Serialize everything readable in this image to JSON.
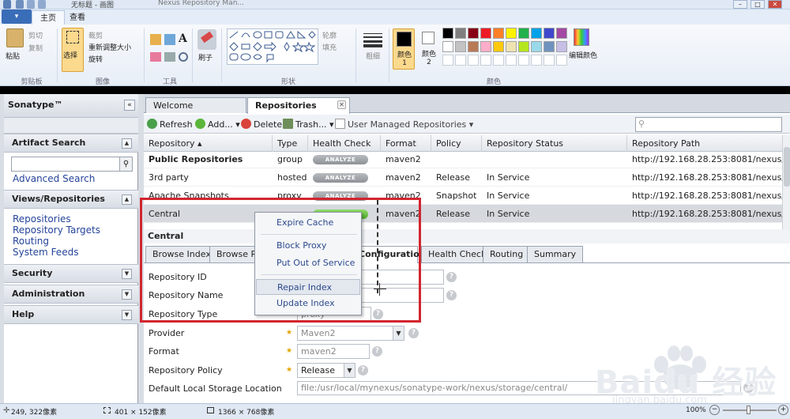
{
  "paint": {
    "title": "无标题 - 画图",
    "bg_tab": "Nexus Repository Man...",
    "file_menu": "▾",
    "tabs": [
      "主页",
      "查看"
    ],
    "clipboard": {
      "paste": "粘贴",
      "cut": "剪切",
      "copy": "复制",
      "label": "剪贴板"
    },
    "image": {
      "select": "选择",
      "crop": "裁剪",
      "resize": "重新调整大小",
      "rotate": "旋转",
      "label": "图像"
    },
    "tools": {
      "label": "工具"
    },
    "brush": {
      "label": "刷子"
    },
    "shapes": {
      "outline": "轮廓",
      "fill": "填充",
      "label": "形状"
    },
    "size": {
      "label": "粗细"
    },
    "colors": {
      "color1": "颜色 1",
      "color2": "颜色 2",
      "edit": "编辑颜色",
      "label": "颜色"
    },
    "palette": [
      "#000000",
      "#7f7f7f",
      "#880015",
      "#ed1c24",
      "#ff7f27",
      "#fff200",
      "#22b14c",
      "#00a2e8",
      "#3f48cc",
      "#a349a4",
      "#ffffff",
      "#c3c3c3",
      "#b97a57",
      "#ffaec9",
      "#ffc90e",
      "#efe4b0",
      "#b5e61d",
      "#99d9ea",
      "#7092be",
      "#c8bfe7"
    ]
  },
  "nexus": {
    "brand": "Sonatype™",
    "left": {
      "artifact_search": "Artifact Search",
      "advanced_search": "Advanced Search",
      "views_repos": "Views/Repositories",
      "links": [
        "Repositories",
        "Repository Targets",
        "Routing",
        "System Feeds"
      ],
      "security": "Security",
      "administration": "Administration",
      "help": "Help"
    },
    "doc_tabs": [
      "Welcome",
      "Repositories"
    ],
    "toolbar": {
      "refresh": "Refresh",
      "add": "Add...",
      "delete": "Delete",
      "trash": "Trash...",
      "user_managed": "User Managed Repositories"
    },
    "columns": [
      "Repository ▴",
      "Type",
      "Health Check",
      "Format",
      "Policy",
      "Repository Status",
      "Repository Path"
    ],
    "analyze_label": "ANALYZE",
    "rows": [
      {
        "name": "Public Repositories",
        "type": "group",
        "format": "maven2",
        "policy": "",
        "status": "",
        "path": "http://192.168.28.253:8081/nexus/co..."
      },
      {
        "name": "3rd party",
        "type": "hosted",
        "format": "maven2",
        "policy": "Release",
        "status": "In Service",
        "path": "http://192.168.28.253:8081/nexus/co..."
      },
      {
        "name": "Apache Snapshots",
        "type": "proxy",
        "format": "maven2",
        "policy": "Snapshot",
        "status": "In Service",
        "path": "http://192.168.28.253:8081/nexus/co..."
      },
      {
        "name": "Central",
        "type": "proxy",
        "format": "maven2",
        "policy": "Release",
        "status": "In Service",
        "path": "http://192.168.28.253:8081/nexus/co..."
      }
    ],
    "detail": {
      "title": "Central",
      "tabs": [
        "Browse Index",
        "Browse Remote",
        "Configuration",
        "Health Check",
        "Routing",
        "Summary"
      ],
      "fields": {
        "repo_id": "Repository ID",
        "repo_name": "Repository Name",
        "repo_type": "Repository Type",
        "repo_type_value": "proxy",
        "provider": "Provider",
        "provider_value": "Maven2",
        "format": "Format",
        "format_value": "maven2",
        "policy": "Repository Policy",
        "policy_value": "Release",
        "storage": "Default Local Storage Location",
        "storage_value": "file:/usr/local/mynexus/sonatype-work/nexus/storage/central/"
      }
    },
    "context_menu": [
      "Expire Cache",
      "Block Proxy",
      "Put Out of Service",
      "Repair Index",
      "Update Index"
    ]
  },
  "status": {
    "cursor_pos": "249, 322像素",
    "selection": "401 × 152像素",
    "image_size": "1366 × 768像素",
    "zoom": "100%"
  },
  "watermark": {
    "brand": "Baidu 经验",
    "url": "jingyan.baidu.com"
  }
}
